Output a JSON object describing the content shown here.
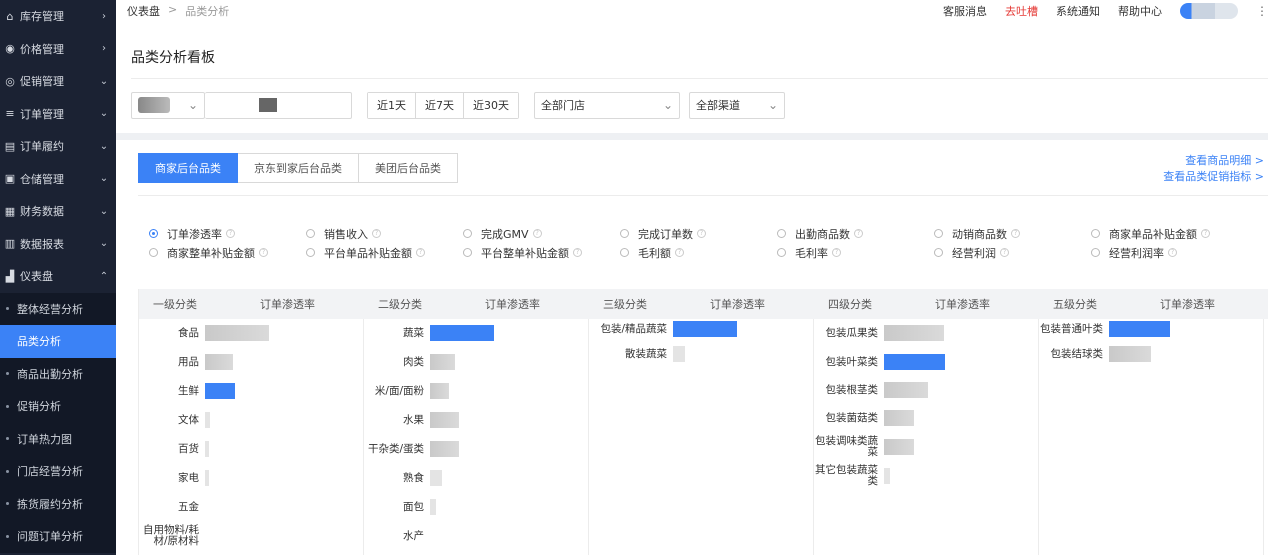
{
  "sidebar": {
    "items": [
      {
        "label": "库存管理",
        "icon": "home-icon",
        "chev": "›"
      },
      {
        "label": "价格管理",
        "icon": "price-icon",
        "chev": "›"
      },
      {
        "label": "促销管理",
        "icon": "promo-icon",
        "chev": "⌄"
      },
      {
        "label": "订单管理",
        "icon": "list-icon",
        "chev": "⌄"
      },
      {
        "label": "订单履约",
        "icon": "fulfill-icon",
        "chev": "⌄"
      },
      {
        "label": "仓储管理",
        "icon": "warehouse-icon",
        "chev": "⌄"
      },
      {
        "label": "财务数据",
        "icon": "finance-icon",
        "chev": "⌄"
      },
      {
        "label": "数据报表",
        "icon": "report-icon",
        "chev": "⌄"
      },
      {
        "label": "仪表盘",
        "icon": "dashboard-icon",
        "chev": "⌃"
      }
    ],
    "sub": [
      {
        "label": "整体经营分析",
        "active": false
      },
      {
        "label": "品类分析",
        "active": true
      },
      {
        "label": "商品出勤分析",
        "active": false
      },
      {
        "label": "促销分析",
        "active": false
      },
      {
        "label": "订单热力图",
        "active": false
      },
      {
        "label": "门店经营分析",
        "active": false
      },
      {
        "label": "拣货履约分析",
        "active": false
      },
      {
        "label": "问题订单分析",
        "active": false
      }
    ]
  },
  "breadcrumb": {
    "root": "仪表盘",
    "sep": ">",
    "current": "品类分析"
  },
  "toplinks": {
    "service": "客服消息",
    "feedback": "去吐槽",
    "notice": "系统通知",
    "help": "帮助中心"
  },
  "page_title": "品类分析看板",
  "filters": {
    "date_buttons": [
      "近1天",
      "近7天",
      "近30天"
    ],
    "store": "全部门店",
    "channel": "全部渠道"
  },
  "tabs": [
    "商家后台品类",
    "京东到家后台品类",
    "美团后台品类"
  ],
  "right_links": [
    "查看商品明细 >",
    "查看品类促销指标 >"
  ],
  "metrics": [
    [
      {
        "label": "订单渗透率",
        "checked": true
      },
      {
        "label": "销售收入",
        "checked": false
      },
      {
        "label": "完成GMV",
        "checked": false
      },
      {
        "label": "完成订单数",
        "checked": false
      },
      {
        "label": "出勤商品数",
        "checked": false
      },
      {
        "label": "动销商品数",
        "checked": false
      },
      {
        "label": "商家单品补贴金额",
        "checked": false
      }
    ],
    [
      {
        "label": "商家整单补贴金额",
        "checked": false
      },
      {
        "label": "平台单品补贴金额",
        "checked": false
      },
      {
        "label": "平台整单补贴金额",
        "checked": false
      },
      {
        "label": "毛利额",
        "checked": false
      },
      {
        "label": "毛利率",
        "checked": false
      },
      {
        "label": "经营利润",
        "checked": false
      },
      {
        "label": "经营利润率",
        "checked": false
      }
    ]
  ],
  "table": {
    "headers": [
      {
        "cat": "一级分类",
        "metric": "订单渗透率"
      },
      {
        "cat": "二级分类",
        "metric": "订单渗透率"
      },
      {
        "cat": "三级分类",
        "metric": "订单渗透率"
      },
      {
        "cat": "四级分类",
        "metric": "订单渗透率"
      },
      {
        "cat": "五级分类",
        "metric": "订单渗透率"
      }
    ],
    "columns": [
      [
        {
          "name": "食品",
          "value": 0.8,
          "color": "gray"
        },
        {
          "name": "用品",
          "value": 0.35,
          "color": "gray"
        },
        {
          "name": "生鲜",
          "value": 0.37,
          "color": "blue"
        },
        {
          "name": "文体",
          "value": 0.06,
          "color": "lg"
        },
        {
          "name": "百货",
          "value": 0.05,
          "color": "lg"
        },
        {
          "name": "家电",
          "value": 0.05,
          "color": "lg"
        },
        {
          "name": "五金",
          "value": 0.0,
          "color": "lg"
        },
        {
          "name": "自用物料/耗材/原材料",
          "value": 0.0,
          "color": "lg"
        }
      ],
      [
        {
          "name": "蔬菜",
          "value": 0.8,
          "color": "blue"
        },
        {
          "name": "肉类",
          "value": 0.31,
          "color": "gray"
        },
        {
          "name": "米/面/面粉",
          "value": 0.24,
          "color": "gray"
        },
        {
          "name": "水果",
          "value": 0.36,
          "color": "gray"
        },
        {
          "name": "干杂类/蛋类",
          "value": 0.36,
          "color": "gray"
        },
        {
          "name": "熟食",
          "value": 0.15,
          "color": "lg"
        },
        {
          "name": "面包",
          "value": 0.07,
          "color": "lg"
        },
        {
          "name": "水产",
          "value": 0.0,
          "color": "lg"
        }
      ],
      [
        {
          "name": "包装/精品蔬菜",
          "value": 0.8,
          "color": "blue"
        },
        {
          "name": "散装蔬菜",
          "value": 0.15,
          "color": "lg"
        }
      ],
      [
        {
          "name": "包装瓜果类",
          "value": 0.75,
          "color": "gray"
        },
        {
          "name": "包装叶菜类",
          "value": 0.76,
          "color": "blue"
        },
        {
          "name": "包装根茎类",
          "value": 0.55,
          "color": "gray"
        },
        {
          "name": "包装菌菇类",
          "value": 0.38,
          "color": "gray"
        },
        {
          "name": "包装调味类蔬菜",
          "value": 0.38,
          "color": "gray"
        },
        {
          "name": "其它包装蔬菜类",
          "value": 0.08,
          "color": "lg"
        }
      ],
      [
        {
          "name": "包装普通叶类",
          "value": 0.76,
          "color": "blue"
        },
        {
          "name": "包装结球类",
          "value": 0.53,
          "color": "gray"
        }
      ]
    ]
  }
}
